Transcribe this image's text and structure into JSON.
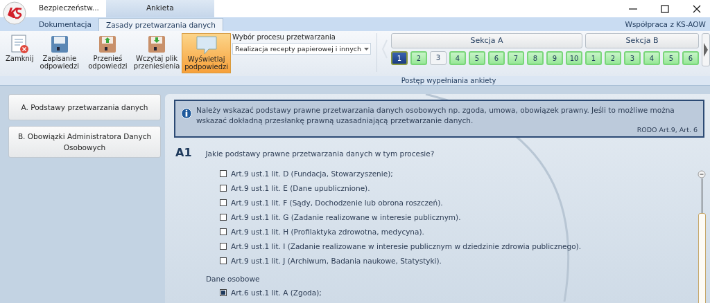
{
  "app_tabs": [
    {
      "label": "Bezpieczeństw..."
    },
    {
      "label": "Ankieta"
    }
  ],
  "ribbon_tabs": [
    {
      "label": "Dokumentacja",
      "selected": false
    },
    {
      "label": "Zasady przetwarzania danych",
      "selected": true
    }
  ],
  "cooperation_link": "Współpraca z KS-AOW",
  "ribbon_buttons": [
    {
      "kind": "close",
      "label": "Zamknij",
      "active": false
    },
    {
      "kind": "save",
      "label": "Zapisanie odpowiedzi",
      "active": false
    },
    {
      "kind": "export",
      "label": "Przenieś odpowiedzi",
      "active": false
    },
    {
      "kind": "import",
      "label": "Wczytaj plik przeniesienia",
      "active": false
    },
    {
      "kind": "hints",
      "label": "Wyświetlaj podpowiedzi",
      "active": true
    }
  ],
  "process_select": {
    "label": "Wybór procesu przetwarzania",
    "value": "Realizacja recepty papierowej i innych"
  },
  "progress": {
    "label": "Postęp wypełniania ankiety",
    "sections": [
      {
        "title": "Sekcja A",
        "questions": [
          {
            "number": "1",
            "selected": true,
            "answered": true
          },
          {
            "number": "2",
            "selected": false,
            "answered": true
          },
          {
            "number": "3",
            "selected": false,
            "answered": false
          },
          {
            "number": "4",
            "selected": false,
            "answered": true
          },
          {
            "number": "5",
            "selected": false,
            "answered": true
          },
          {
            "number": "6",
            "selected": false,
            "answered": true
          },
          {
            "number": "7",
            "selected": false,
            "answered": true
          },
          {
            "number": "8",
            "selected": false,
            "answered": true
          },
          {
            "number": "9",
            "selected": false,
            "answered": true
          },
          {
            "number": "10",
            "selected": false,
            "answered": true
          }
        ]
      },
      {
        "title": "Sekcja B",
        "questions": [
          {
            "number": "1",
            "selected": false,
            "answered": true
          },
          {
            "number": "2",
            "selected": false,
            "answered": true
          },
          {
            "number": "3",
            "selected": false,
            "answered": true
          },
          {
            "number": "4",
            "selected": false,
            "answered": true
          },
          {
            "number": "5",
            "selected": false,
            "answered": true
          },
          {
            "number": "6",
            "selected": false,
            "answered": true
          }
        ]
      }
    ]
  },
  "sidebar": {
    "items": [
      {
        "label": "A. Podstawy przetwarzania danych"
      },
      {
        "label": "B. Obowiązki Administratora Danych Osobowych"
      }
    ]
  },
  "info": {
    "text": "Należy wskazać podstawy prawne przetwarzania danych osobowych np. zgoda, umowa, obowiązek prawny. Jeśli to możliwe można wskazać dokładną przesłankę prawną uzasadniającą przetwarzanie danych.",
    "reference": "RODO Art.9, Art. 6"
  },
  "question": {
    "number": "A1",
    "text": "Jakie podstawy prawne przetwarzania danych w tym procesie?",
    "groups": [
      {
        "options": [
          {
            "label": "Art.9 ust.1 lit. D (Fundacja, Stowarzyszenie);",
            "checked": false
          },
          {
            "label": "Art.9 ust.1 lit. E (Dane upublicznione).",
            "checked": false
          },
          {
            "label": "Art.9 ust.1 lit. F (Sądy, Dochodzenie lub obrona roszczeń).",
            "checked": false
          },
          {
            "label": "Art.9 ust.1 lit. G (Zadanie realizowane w interesie publicznym).",
            "checked": false
          },
          {
            "label": "Art.9 ust.1 lit. H (Profilaktyka zdrowotna, medycyna).",
            "checked": false
          },
          {
            "label": "Art.9 ust.1 lit. I (Zadanie realizowane w interesie publicznym w dziedzinie zdrowia publicznego).",
            "checked": false
          },
          {
            "label": "Art.9 ust.1 lit. J (Archiwum, Badania naukowe, Statystyki).",
            "checked": false
          }
        ]
      },
      {
        "title": "Dane osobowe",
        "options": [
          {
            "label": "Art.6 ust.1 lit. A (Zgoda);",
            "checked": true
          }
        ]
      }
    ]
  }
}
